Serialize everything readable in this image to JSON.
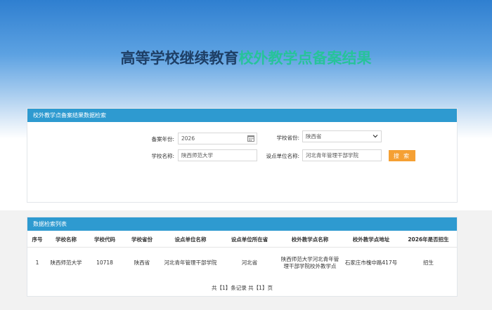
{
  "page_title": {
    "part1": "高等学校继续教育",
    "part2": "校外教学点备案结果"
  },
  "colors": {
    "header_bar": "#2e9ad0",
    "title_dark": "#1e3f66",
    "title_green": "#27c39a",
    "search_button": "#f5a033"
  },
  "search_panel": {
    "title": "校外教学点备案结果数据检索",
    "year_label": "备案年份:",
    "year_value": "2026",
    "province_label": "学校省份:",
    "province_value": "陕西省",
    "school_label": "学校名称:",
    "school_value": "陕西师范大学",
    "unit_label": "设点单位名称:",
    "unit_value": "河北青年管理干部学院",
    "search_button": "搜 索"
  },
  "results_panel": {
    "title": "数据检索列表",
    "columns": [
      "序号",
      "学校名称",
      "学校代码",
      "学校省份",
      "设点单位名称",
      "设点单位所在省",
      "校外教学点名称",
      "校外教学点地址",
      "2026年是否招生"
    ],
    "rows": [
      [
        "1",
        "陕西师范大学",
        "10718",
        "陕西省",
        "河北青年管理干部学院",
        "河北省",
        "陕西师范大学河北青年管理干部学院校外教学点",
        "石家庄市槐中路417号",
        "招生"
      ]
    ],
    "pager": "共【1】条记录 共【1】页"
  }
}
